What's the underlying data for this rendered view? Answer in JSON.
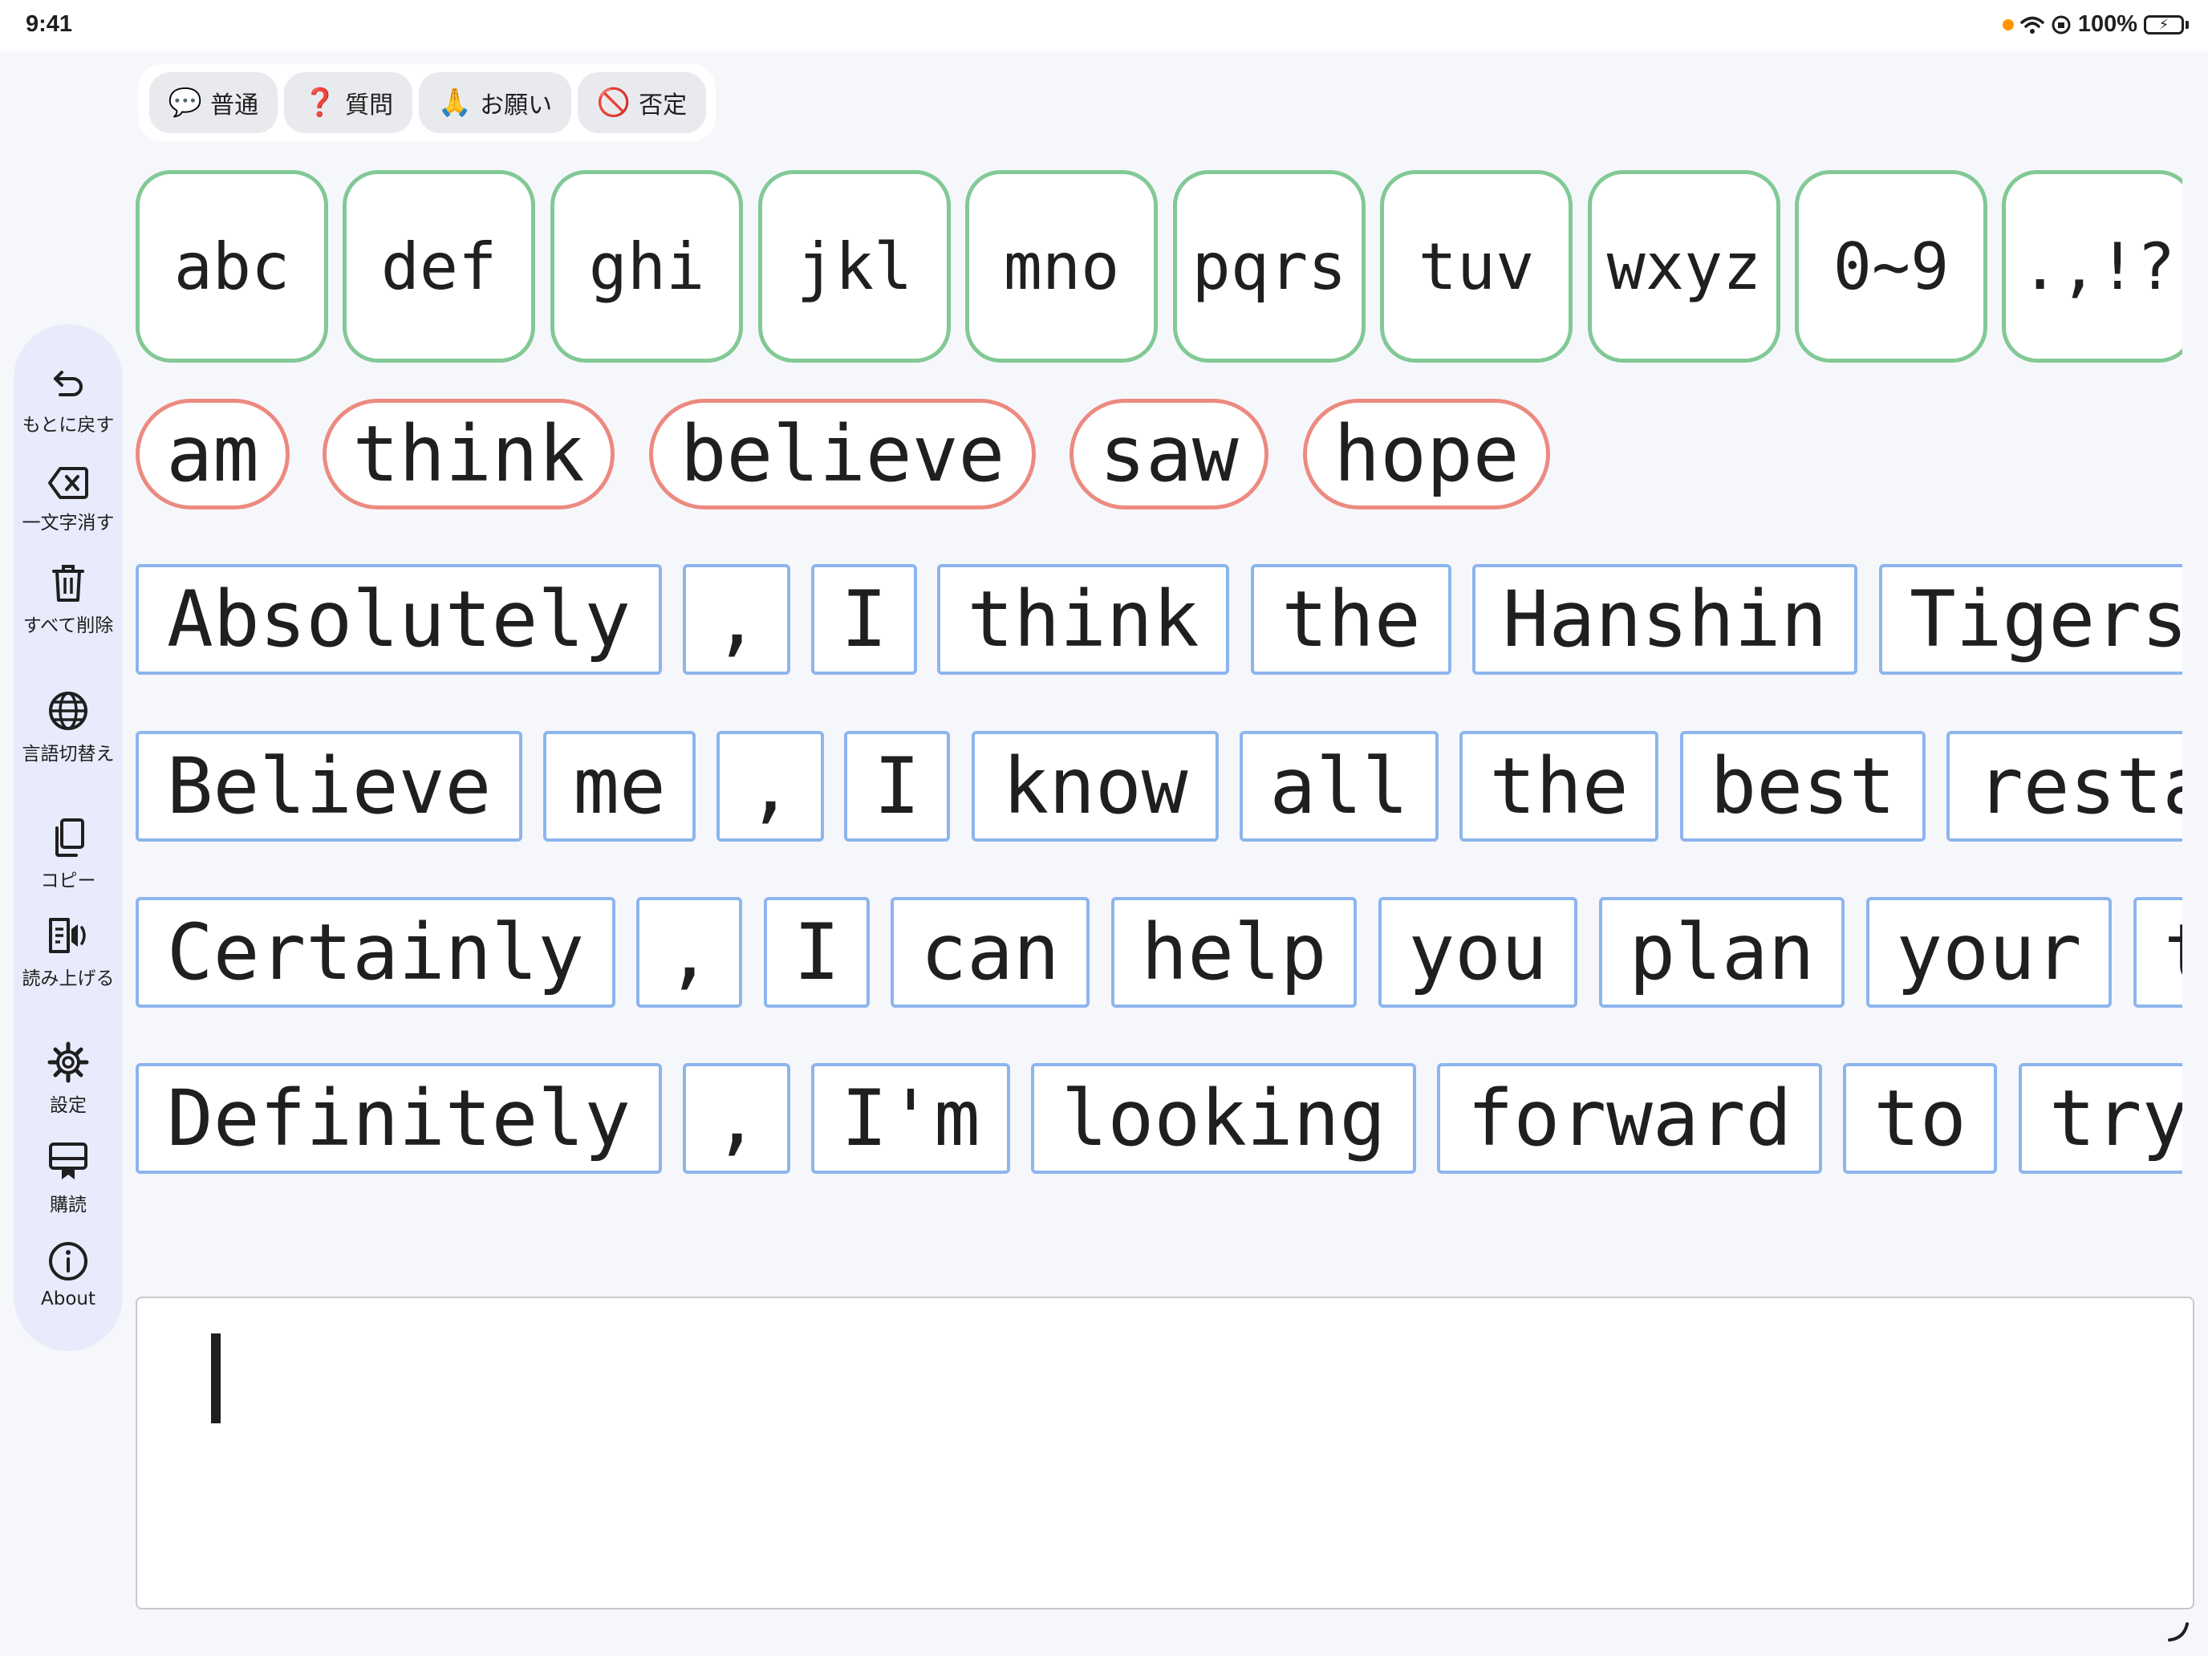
{
  "status_bar": {
    "time": "9:41",
    "battery": "100%"
  },
  "modes": [
    {
      "emoji": "💬",
      "label": "普通"
    },
    {
      "emoji": "❓",
      "label": "質問"
    },
    {
      "emoji": "🙏",
      "label": "お願い"
    },
    {
      "emoji": "🚫",
      "label": "否定"
    }
  ],
  "sidebar": {
    "undo": "もとに戻す",
    "backspace": "一文字消す",
    "clear_all": "すべて削除",
    "language": "言語切替え",
    "copy": "コピー",
    "speak": "読み上げる",
    "settings": "設定",
    "subscribe": "購読",
    "about": "About"
  },
  "letter_keys": [
    "abc",
    "def",
    "ghi",
    "jkl",
    "mno",
    "pqrs",
    "tuv",
    "wxyz",
    "0~9",
    ".,!?"
  ],
  "predictions": [
    "am",
    "think",
    "believe",
    "saw",
    "hope"
  ],
  "sentences": [
    [
      "Absolutely",
      ",",
      "I",
      "think",
      "the",
      "Hanshin",
      "Tigers"
    ],
    [
      "Believe",
      "me",
      ",",
      "I",
      "know",
      "all",
      "the",
      "best",
      "resta"
    ],
    [
      "Certainly",
      ",",
      "I",
      "can",
      "help",
      "you",
      "plan",
      "your",
      "t"
    ],
    [
      "Definitely",
      ",",
      "I'm",
      "looking",
      "forward",
      "to",
      "try"
    ]
  ],
  "input": {
    "text": ""
  }
}
